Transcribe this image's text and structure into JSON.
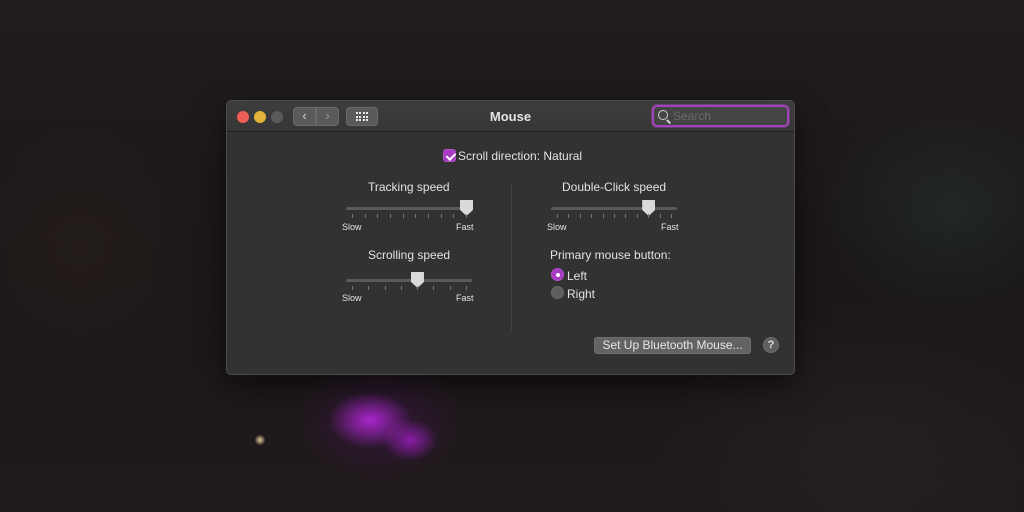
{
  "window": {
    "title": "Mouse"
  },
  "toolbar": {
    "back_glyph": "‹",
    "forward_glyph": "›",
    "search_placeholder": "Search"
  },
  "scroll_direction": {
    "label": "Scroll direction: Natural",
    "checked": true
  },
  "tracking": {
    "label": "Tracking speed",
    "min_label": "Slow",
    "max_label": "Fast",
    "ticks": 10,
    "value": 1.0
  },
  "scrolling": {
    "label": "Scrolling speed",
    "min_label": "Slow",
    "max_label": "Fast",
    "ticks": 8,
    "value": 0.57
  },
  "double_click": {
    "label": "Double-Click speed",
    "min_label": "Slow",
    "max_label": "Fast",
    "ticks": 11,
    "value": 0.8
  },
  "primary_button": {
    "label": "Primary mouse button:",
    "options": [
      {
        "label": "Left",
        "selected": true
      },
      {
        "label": "Right",
        "selected": false
      }
    ]
  },
  "setup_button": "Set Up Bluetooth Mouse...",
  "help_glyph": "?",
  "colors": {
    "accent": "#a63ac1",
    "window_bg": "#323232"
  }
}
